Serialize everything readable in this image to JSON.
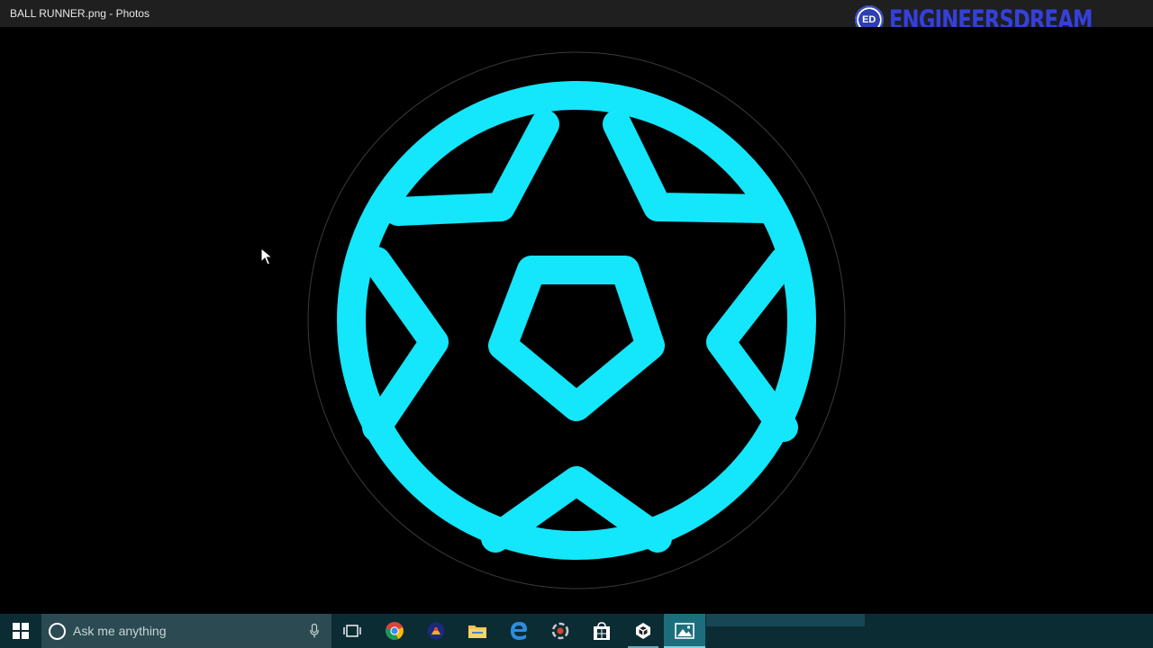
{
  "window": {
    "title": "BALL RUNNER.png - Photos"
  },
  "watermark": {
    "badge": "ED",
    "text": "ENGINEERSDREAM"
  },
  "image": {
    "subject": "soccer-ball-icon",
    "stroke_color": "#14e6fb",
    "background_color": "#000000"
  },
  "taskbar": {
    "search_placeholder": "Ask me anything",
    "icons": [
      "windows-start-icon",
      "task-view-icon",
      "chrome-icon",
      "app-icon",
      "file-explorer-icon",
      "edge-icon",
      "app-icon",
      "store-icon",
      "unity-icon",
      "photos-icon"
    ]
  }
}
